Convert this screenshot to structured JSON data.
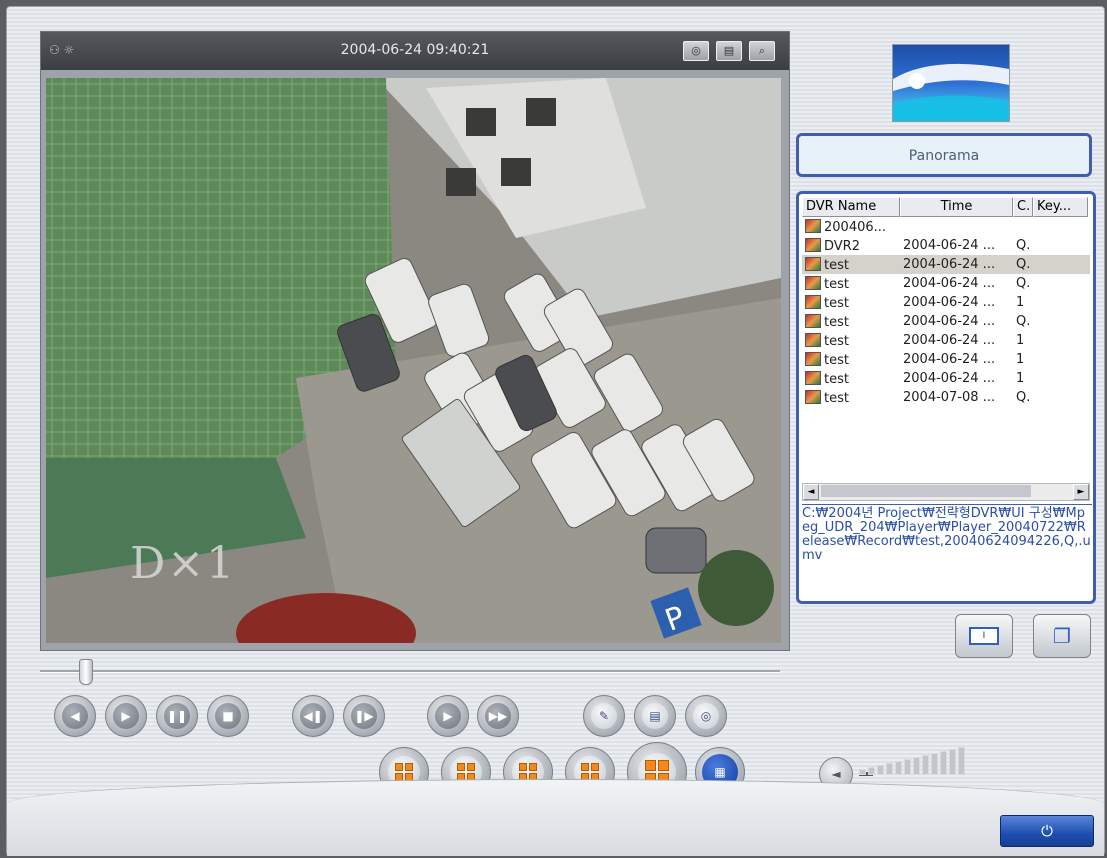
{
  "video": {
    "timestamp": "2004-06-24 09:40:21",
    "channel_overlay": "D×1",
    "status_icons": [
      "camera-status-icon",
      "signal-icon"
    ],
    "top_buttons": [
      "snapshot-icon",
      "print-icon",
      "zoom-icon"
    ]
  },
  "panorama_label": "Panorama",
  "list": {
    "columns": [
      "DVR Name",
      "Time",
      "C.",
      "Key..."
    ],
    "rows": [
      {
        "name": "200406...",
        "time": "",
        "c": ""
      },
      {
        "name": "DVR2",
        "time": "2004-06-24 ...",
        "c": "Q."
      },
      {
        "name": "test",
        "time": "2004-06-24 ...",
        "c": "Q."
      },
      {
        "name": "test",
        "time": "2004-06-24 ...",
        "c": "Q."
      },
      {
        "name": "test",
        "time": "2004-06-24 ...",
        "c": "1"
      },
      {
        "name": "test",
        "time": "2004-06-24 ...",
        "c": "Q."
      },
      {
        "name": "test",
        "time": "2004-06-24 ...",
        "c": "1"
      },
      {
        "name": "test",
        "time": "2004-06-24 ...",
        "c": "1"
      },
      {
        "name": "test",
        "time": "2004-06-24 ...",
        "c": "1"
      },
      {
        "name": "test",
        "time": "2004-07-08 ...",
        "c": "Q."
      }
    ],
    "selected_index": 2
  },
  "file_path": "C:₩2004년 Project₩전략형DVR₩UI 구성₩Mpeg_UDR_204₩Player₩Player_20040722₩Release₩Record₩test,20040624094226,Q,.umv",
  "playback_position": 0.05,
  "colors": {
    "accent_blue": "#3f5eaf",
    "split_orange": "#f08a1c",
    "power_blue": "#1d4fb0"
  }
}
